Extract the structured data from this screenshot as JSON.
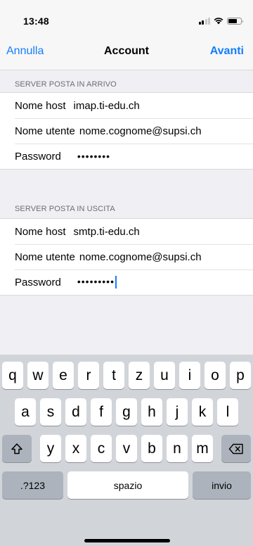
{
  "status_bar": {
    "time": "13:48"
  },
  "nav": {
    "left_label": "Annulla",
    "title": "Account",
    "right_label": "Avanti"
  },
  "incoming": {
    "header": "SERVER POSTA IN ARRIVO",
    "rows": [
      {
        "label": "Nome host",
        "value": "imap.ti-edu.ch"
      },
      {
        "label": "Nome utente",
        "value": "nome.cognome@supsi.ch"
      },
      {
        "label": "Password",
        "value": "••••••••"
      }
    ]
  },
  "outgoing": {
    "header": "SERVER POSTA IN USCITA",
    "rows": [
      {
        "label": "Nome host",
        "value": "smtp.ti-edu.ch"
      },
      {
        "label": "Nome utente",
        "value": "nome.cognome@supsi.ch"
      },
      {
        "label": "Password",
        "value": "•••••••••"
      }
    ]
  },
  "keyboard": {
    "row1": [
      "q",
      "w",
      "e",
      "r",
      "t",
      "z",
      "u",
      "i",
      "o",
      "p"
    ],
    "row2": [
      "a",
      "s",
      "d",
      "f",
      "g",
      "h",
      "j",
      "k",
      "l"
    ],
    "row3": [
      "y",
      "x",
      "c",
      "v",
      "b",
      "n",
      "m"
    ],
    "numbers_label": ".?123",
    "space_label": "spazio",
    "return_label": "invio",
    "shift_icon": "shift-icon",
    "delete_icon": "delete-icon"
  },
  "colors": {
    "accent": "#147efb",
    "background": "#efeff4",
    "keyboard": "#d1d4d9"
  }
}
